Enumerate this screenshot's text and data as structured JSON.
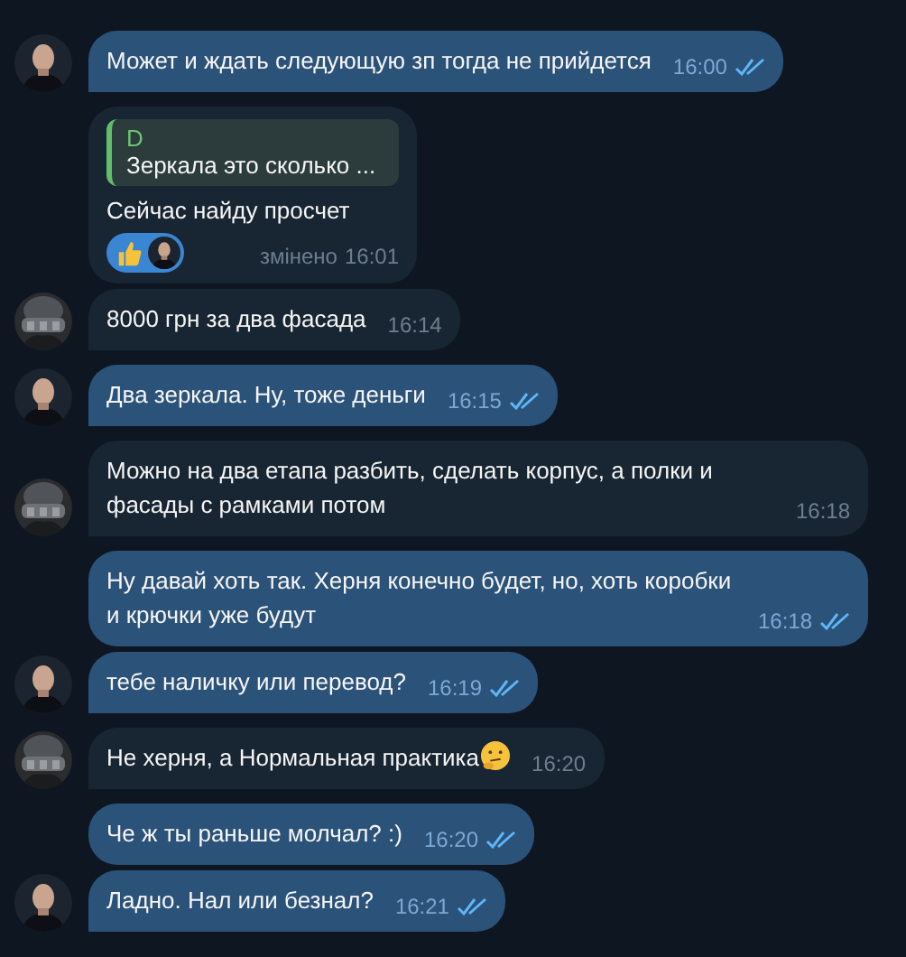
{
  "messages": [
    {
      "kind": "outgoing",
      "text": "Может и ждать следующую зп тогда не прийдется",
      "time": "16:00",
      "read": true,
      "avatar": true
    },
    {
      "kind": "incoming",
      "reply": {
        "name": "D",
        "text": "Зеркала это сколько ..."
      },
      "text": "Сейчас найду просчет",
      "reaction": {
        "kind": "thumbs-up"
      },
      "edited": "змінено",
      "time": "16:01",
      "avatar": false
    },
    {
      "kind": "incoming",
      "text": "8000 грн за два фасада",
      "time": "16:14",
      "avatar": true
    },
    {
      "kind": "outgoing",
      "text": "Два зеркала. Ну, тоже деньги",
      "time": "16:15",
      "read": true,
      "avatar": true
    },
    {
      "kind": "incoming",
      "text": "Можно на два етапа разбить, сделать корпус, а полки и фасады с рамками потом",
      "time": "16:18",
      "avatar": true
    },
    {
      "kind": "outgoing",
      "text": "Ну давай хоть так. Херня конечно будет, но, хоть коробки и крючки уже будут",
      "time": "16:18",
      "read": true,
      "avatar": false
    },
    {
      "kind": "outgoing",
      "text": "тебе наличку или перевод?",
      "time": "16:19",
      "read": true,
      "avatar": true
    },
    {
      "kind": "incoming",
      "text": "Не херня, а Нормальная практика",
      "thinking_emoji": true,
      "time": "16:20",
      "avatar": true
    },
    {
      "kind": "outgoing",
      "text": "Че ж ты раньше молчал? :)",
      "time": "16:20",
      "read": true,
      "avatar": false
    },
    {
      "kind": "outgoing",
      "text": "Ладно. Нал или безнал?",
      "time": "16:21",
      "read": true,
      "avatar": true
    }
  ]
}
